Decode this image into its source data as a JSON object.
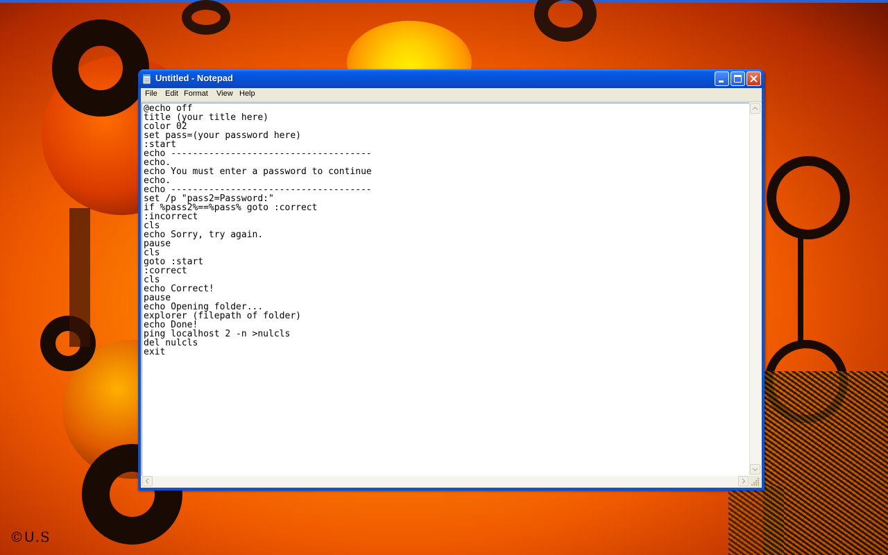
{
  "desktop": {
    "watermark": "©ᑌ.S",
    "accent_colors": {
      "orange": "#ff8a00",
      "dark": "#1a0a04",
      "taskbar_blue": "#2a62d8"
    }
  },
  "window": {
    "title": "Untitled - Notepad",
    "icon": "notepad-icon",
    "controls": {
      "minimize": "minimize-icon",
      "maximize": "maximize-icon",
      "close": "close-icon"
    },
    "titlebar_color": "#0553da"
  },
  "menu": {
    "items": [
      "File",
      "Edit",
      "Format",
      "View",
      "Help"
    ]
  },
  "editor": {
    "lines": [
      "@echo off",
      "title (your title here)",
      "color 02",
      "set pass=(your password here)",
      ":start",
      "echo -------------------------------------",
      "echo.",
      "echo You must enter a password to continue",
      "echo.",
      "echo -------------------------------------",
      "set /p \"pass2=Password:\"",
      "if %pass2%==%pass% goto :correct",
      ":incorrect",
      "cls",
      "echo Sorry, try again.",
      "pause",
      "cls",
      "goto :start",
      ":correct",
      "cls",
      "echo Correct!",
      "pause",
      "echo Opening folder...",
      "explorer (filepath of folder)",
      "echo Done!",
      "ping localhost 2 -n >nulcls",
      "del nulcls",
      "exit"
    ]
  }
}
